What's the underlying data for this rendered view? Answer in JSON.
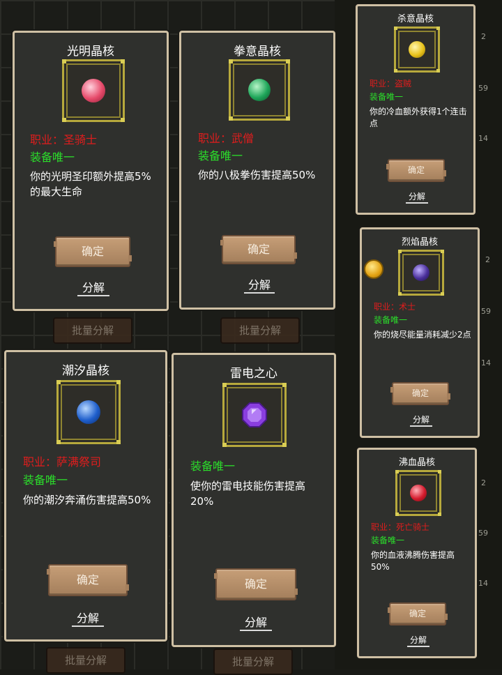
{
  "cards": [
    {
      "id": "light",
      "title": "光明晶核",
      "role": "职业：圣骑士",
      "unique": "装备唯一",
      "desc": "你的光明圣印额外提高5%的最大生命",
      "confirm": "确定",
      "decompose": "分解",
      "gem_color": "#e64a6a"
    },
    {
      "id": "fist",
      "title": "拳意晶核",
      "role": "职业：武僧",
      "unique": "装备唯一",
      "desc": "你的八极拳伤害提高50%",
      "confirm": "确定",
      "decompose": "分解",
      "gem_color": "#1fa65a"
    },
    {
      "id": "kill",
      "title": "杀意晶核",
      "role": "职业：盗贼",
      "unique": "装备唯一",
      "desc": "你的冷血额外获得1个连击点",
      "confirm": "确定",
      "decompose": "分解",
      "gem_color": "#e8c21a"
    },
    {
      "id": "flame",
      "title": "烈焰晶核",
      "role": "职业：术士",
      "unique": "装备唯一",
      "desc": "你的烧尽能量消耗减少2点",
      "confirm": "确定",
      "decompose": "分解",
      "gem_color": "#4a2f9a"
    },
    {
      "id": "tide",
      "title": "潮汐晶核",
      "role": "职业：萨满祭司",
      "unique": "装备唯一",
      "desc": "你的潮汐奔涌伤害提高50%",
      "confirm": "确定",
      "decompose": "分解",
      "gem_color": "#1f5fcc"
    },
    {
      "id": "thunder",
      "title": "雷电之心",
      "unique": "装备唯一",
      "desc": "使你的雷电技能伤害提高20%",
      "confirm": "确定",
      "decompose": "分解",
      "gem_color": "#8a3ee0"
    },
    {
      "id": "blood",
      "title": "沸血晶核",
      "role": "职业：死亡骑士",
      "unique": "装备唯一",
      "desc": "你的血液沸腾伤害提高50%",
      "confirm": "确定",
      "decompose": "分解",
      "gem_color": "#d51c2e"
    }
  ],
  "background": {
    "batch_label": "批量分解",
    "counts": [
      "2",
      "59",
      "14",
      "2",
      "59",
      "14",
      "2",
      "59",
      "14"
    ]
  }
}
